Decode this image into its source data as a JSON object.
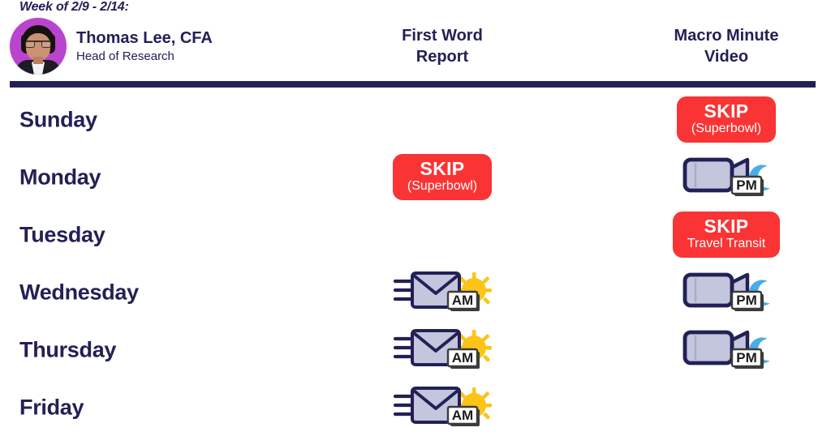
{
  "week_label": "Week of 2/9 - 2/14:",
  "analyst": {
    "name": "Thomas Lee, CFA",
    "role": "Head of Research",
    "avatar_icon": "analyst-avatar-photo"
  },
  "columns": [
    {
      "id": "first-word-report",
      "line1": "First Word",
      "line2": "Report"
    },
    {
      "id": "macro-minute-video",
      "line1": "Macro Minute",
      "line2": "Video"
    }
  ],
  "colors": {
    "navy": "#232056",
    "skip_red": "#fa3434",
    "avatar_bg": "#b944cf",
    "sun_yellow": "#fcc419",
    "moon_blue": "#4aadea",
    "icon_fill": "#c3c6dc"
  },
  "rows": [
    {
      "day": "Sunday",
      "first_word": {
        "type": "none"
      },
      "macro_minute": {
        "type": "skip",
        "main": "SKIP",
        "sub": "(Superbowl)"
      }
    },
    {
      "day": "Monday",
      "first_word": {
        "type": "skip",
        "main": "SKIP",
        "sub": "(Superbowl)"
      },
      "macro_minute": {
        "type": "video",
        "badge": "PM",
        "icon": "video-camera-moon-icon"
      }
    },
    {
      "day": "Tuesday",
      "first_word": {
        "type": "none"
      },
      "macro_minute": {
        "type": "skip",
        "main": "SKIP",
        "sub": "Travel Transit"
      }
    },
    {
      "day": "Wednesday",
      "first_word": {
        "type": "email",
        "badge": "AM",
        "icon": "email-envelope-sun-icon"
      },
      "macro_minute": {
        "type": "video",
        "badge": "PM",
        "icon": "video-camera-moon-icon"
      }
    },
    {
      "day": "Thursday",
      "first_word": {
        "type": "email",
        "badge": "AM",
        "icon": "email-envelope-sun-icon"
      },
      "macro_minute": {
        "type": "video",
        "badge": "PM",
        "icon": "video-camera-moon-icon"
      }
    },
    {
      "day": "Friday",
      "first_word": {
        "type": "email",
        "badge": "AM",
        "icon": "email-envelope-sun-icon"
      },
      "macro_minute": {
        "type": "none"
      }
    }
  ]
}
